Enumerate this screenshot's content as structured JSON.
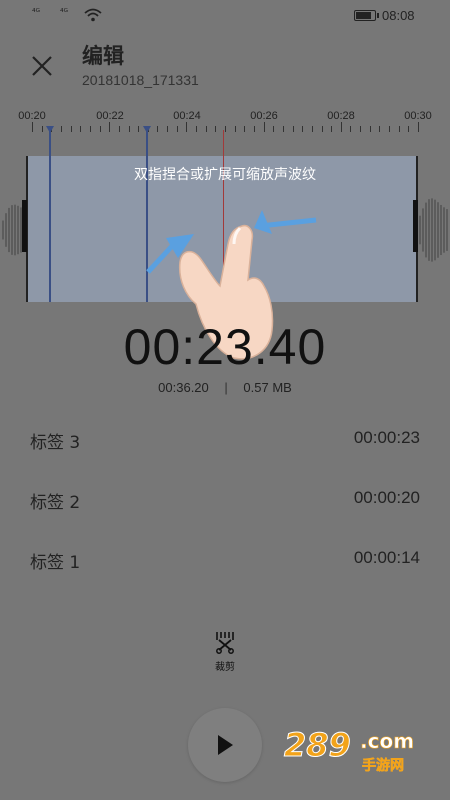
{
  "status_bar": {
    "signal_1": "⁴ᴳ",
    "signal_2": "⁴ᴳ",
    "time": "08:08"
  },
  "header": {
    "title": "编辑",
    "subtitle": "20181018_171331"
  },
  "ruler": {
    "ticks": [
      "00:20",
      "00:22",
      "00:24",
      "00:26",
      "00:28",
      "00:30"
    ]
  },
  "hint": "双指捏合或扩展可缩放声波纹",
  "player": {
    "current_time": "00:23.40",
    "duration": "00:36.20",
    "separator": "|",
    "size": "0.57 MB"
  },
  "labels": [
    {
      "name": "标签 3",
      "time": "00:00:23"
    },
    {
      "name": "标签 2",
      "time": "00:00:20"
    },
    {
      "name": "标签 1",
      "time": "00:00:14"
    }
  ],
  "toolbar": {
    "cut_label": "裁剪"
  },
  "watermark": {
    "brand": "289",
    "domain": ".com",
    "subtitle": "手游网"
  },
  "colors": {
    "background": "#777777",
    "selection": "#8e98a8",
    "marker": "#3a4f85",
    "playhead": "#a23a3a",
    "watermark_orange": "#f2a31a"
  }
}
